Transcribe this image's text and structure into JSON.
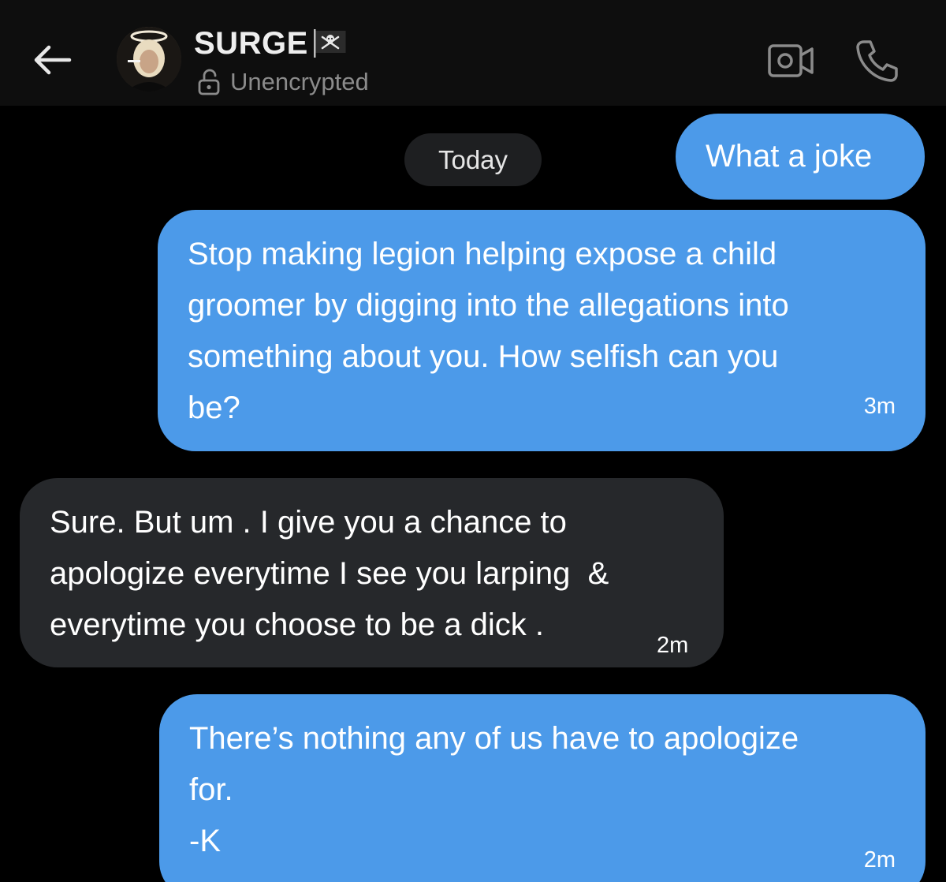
{
  "header": {
    "contact_name": "SURGE",
    "encryption_status": "Unencrypted",
    "icons": {
      "back": "arrow-left-icon",
      "flag": "pirate-flag-icon",
      "lock": "unlock-icon",
      "video": "video-camera-icon",
      "call": "phone-icon"
    }
  },
  "date_separator": "Today",
  "messages": [
    {
      "direction": "outgoing",
      "lines": [
        "What a joke"
      ],
      "time": ""
    },
    {
      "direction": "outgoing",
      "lines": [
        "Stop making legion helping expose a child",
        "groomer by digging into the allegations into",
        "something about you. How selfish can you",
        "be?"
      ],
      "time": "3m"
    },
    {
      "direction": "incoming",
      "lines": [
        "Sure. But um . I give you a chance to",
        "apologize everytime I see you larping  &",
        "everytime you choose to be a dick ."
      ],
      "time": "2m"
    },
    {
      "direction": "outgoing",
      "lines": [
        "There’s nothing any of us have to apologize",
        "for.",
        "-K"
      ],
      "time": "2m"
    }
  ],
  "colors": {
    "background": "#000000",
    "header_background": "#0e0e0e",
    "outgoing_bubble": "#4c9ae9",
    "incoming_bubble": "#26282b",
    "date_pill": "#1e1f21",
    "secondary_text": "#8b8b8b"
  }
}
